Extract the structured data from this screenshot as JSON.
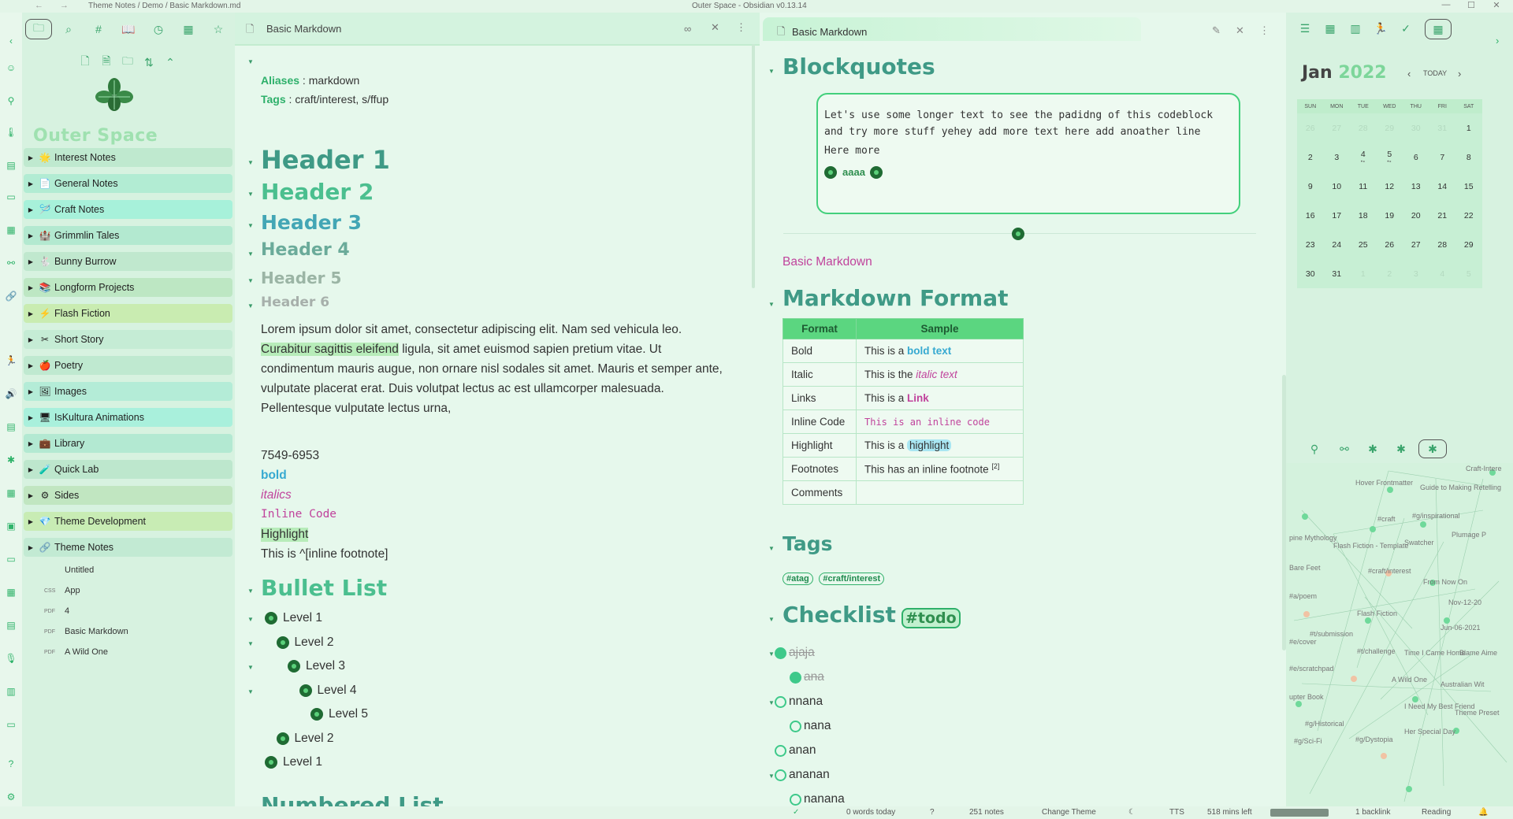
{
  "titlebar": {
    "path": "Theme Notes / Demo / Basic Markdown.md",
    "title": "Outer Space - Obsidian v0.13.14",
    "back": "←",
    "forward": "→",
    "minimize": "—",
    "maximize": "☐",
    "close": "✕"
  },
  "ribbon": {
    "icons": [
      "chevron-left-icon",
      "smile-icon",
      "bike-icon",
      "thermometer-icon",
      "layers-icon",
      "film-icon",
      "calendar-icon",
      "network-icon",
      "link-icon",
      "run-icon",
      "speaker-icon",
      "document-icon",
      "graph-icon",
      "calendar-2-icon",
      "gallery-icon",
      "cards-icon",
      "grid-icon",
      "table-icon",
      "mic-icon",
      "layout-icon",
      "id-card-icon",
      "help-icon",
      "settings-icon"
    ]
  },
  "left_sidebar": {
    "vault_name": "Outer Space",
    "folders": [
      {
        "name": "Interest Notes",
        "icon": "🌟",
        "color": "#bfe9cf"
      },
      {
        "name": "General Notes",
        "icon": "📄",
        "color": "#b2ecd3"
      },
      {
        "name": "Craft Notes",
        "icon": "🪡",
        "color": "#a7f1da"
      },
      {
        "name": "Grimmlin Tales",
        "icon": "🏰",
        "color": "#b3e9d0"
      },
      {
        "name": "Bunny Burrow",
        "icon": "🐇",
        "color": "#c0e8ce"
      },
      {
        "name": "Longform Projects",
        "icon": "📚",
        "color": "#bde7c3"
      },
      {
        "name": "Flash Fiction",
        "icon": "⚡",
        "color": "#c9ecb1"
      },
      {
        "name": "Short Story",
        "icon": "✂",
        "color": "#c5ecd5"
      },
      {
        "name": "Poetry",
        "icon": "🍎",
        "color": "#bfe9d0"
      },
      {
        "name": "Images",
        "icon": "🖼",
        "color": "#b4ecd7"
      },
      {
        "name": "IsKultura Animations",
        "icon": "🖥",
        "color": "#a9f0dc"
      },
      {
        "name": "Library",
        "icon": "💼",
        "color": "#b3e9d2"
      },
      {
        "name": "Quick Lab",
        "icon": "🧪",
        "color": "#bde7cd"
      },
      {
        "name": "Sides",
        "icon": "⚙",
        "color": "#c1e6c1"
      },
      {
        "name": "Theme Development",
        "icon": "💎",
        "color": "#c8ecb4"
      },
      {
        "name": "Theme Notes",
        "icon": "🔗",
        "color": "#c2ead3"
      }
    ],
    "files": [
      {
        "badge": "",
        "name": "Untitled"
      },
      {
        "badge": "CSS",
        "name": "App"
      },
      {
        "badge": "PDF",
        "name": "4"
      },
      {
        "badge": "PDF",
        "name": "Basic Markdown"
      },
      {
        "badge": "PDF",
        "name": "A Wild One"
      }
    ]
  },
  "center": {
    "tab_title": "Basic Markdown",
    "aliases_key": "Aliases",
    "aliases_value": "markdown",
    "tags_key": "Tags",
    "tags_value": "craft/interest, s/ffup",
    "h1": "Header 1",
    "h2": "Header 2",
    "h3": "Header 3",
    "h4": "Header 4",
    "h5": "Header 5",
    "h6": "Header 6",
    "para_1": "Lorem ipsum dolor sit amet, consectetur adipiscing elit. Nam sed vehicula leo. ",
    "para_hl": "Curabitur sagittis eleifend",
    "para_2": " ligula, sit amet euismod sapien pretium vitae. Ut condimentum mauris augue, non ornare nisl sodales sit amet. Mauris et semper ante, vulputate placerat erat. Duis volutpat lectus ac est ullamcorper malesuada. Pellentesque vulputate lectus urna,",
    "phone": "7549-6953",
    "bold": "bold",
    "italics": "italics",
    "inline_code": "Inline Code",
    "highlight": "Highlight",
    "footnote_line": "This is ^[inline footnote]",
    "bullet_header": "Bullet List",
    "bullets": [
      "Level 1",
      "Level 2",
      "Level 3",
      "Level 4",
      "Level 5",
      "Level 2",
      "Level 1"
    ],
    "next_header": "Numbered List"
  },
  "right": {
    "tab_title": "Basic Markdown",
    "blockquotes_header": "Blockquotes",
    "quote_text": "Let's use some longer text to see the padidng of this codeblock and try more stuff yehey add more text here add anoather line",
    "quote_more": "Here more",
    "quote_aaaa": "aaaa",
    "link_title": "Basic Markdown",
    "format_header": "Markdown Format",
    "table_headers": [
      "Format",
      "Sample"
    ],
    "table_rows": [
      {
        "format": "Bold",
        "prefix": "This is a ",
        "sample": "bold text"
      },
      {
        "format": "Italic",
        "prefix": "This is the ",
        "sample": "italic text"
      },
      {
        "format": "Links",
        "prefix": "This is a ",
        "sample": "Link"
      },
      {
        "format": "Inline Code",
        "prefix": "",
        "sample": "This is an inline code"
      },
      {
        "format": "Highlight",
        "prefix": "This is a ",
        "sample": "highlight"
      },
      {
        "format": "Footnotes",
        "prefix": "This has an inline footnote ",
        "sample": "[2]"
      },
      {
        "format": "Comments",
        "prefix": "",
        "sample": ""
      }
    ],
    "tags_header": "Tags",
    "tags": [
      "#atag",
      "#craft/interest"
    ],
    "checklist_header": "Checklist",
    "checklist_tag": "#todo",
    "checklist": [
      {
        "text": "ajaja",
        "done": true
      },
      {
        "text": "ana",
        "done": true
      },
      {
        "text": "nnana",
        "done": false
      },
      {
        "text": "nana",
        "done": false
      },
      {
        "text": "anan",
        "done": false
      },
      {
        "text": "ananan",
        "done": false
      },
      {
        "text": "nanana",
        "done": false
      }
    ]
  },
  "calendar": {
    "month": "Jan",
    "year": "2022",
    "today": "TODAY",
    "days": [
      "SUN",
      "MON",
      "TUE",
      "WED",
      "THU",
      "FRI",
      "SAT"
    ],
    "weeks": [
      [
        "26",
        "27",
        "28",
        "29",
        "30",
        "31",
        "1"
      ],
      [
        "2",
        "3",
        "4",
        "5",
        "6",
        "7",
        "8"
      ],
      [
        "9",
        "10",
        "11",
        "12",
        "13",
        "14",
        "15"
      ],
      [
        "16",
        "17",
        "18",
        "19",
        "20",
        "21",
        "22"
      ],
      [
        "23",
        "24",
        "25",
        "26",
        "27",
        "28",
        "29"
      ],
      [
        "30",
        "31",
        "1",
        "2",
        "3",
        "4",
        "5"
      ]
    ]
  },
  "graph": {
    "labels": [
      "Craft-Intere",
      "Hover Frontmatter",
      "Guide to Making Retelling",
      "#g/inspirational",
      "#craft",
      "Plumage P",
      "pine Mythology",
      "Flash Fiction - Template",
      "Swatcher",
      "Bare Feet",
      "#craft/interest",
      "From Now On",
      "#a/poem",
      "Nov-12-20",
      "Flash Fiction",
      "#t/submission",
      "Jun-06-2021",
      "#e/cover",
      "#t/challenge",
      "Time I Came Home",
      "Blame Aime",
      "#e/scratchpad",
      "A Wild One",
      "Australian Wit",
      "upter Book",
      "I Need My Best Friend",
      "Theme Preset",
      "#g/Historical",
      "#g/Sci-Fi",
      "Her Special Day",
      "#g/Dystopia"
    ]
  },
  "status": {
    "words": "0 words today",
    "notes": "251 notes",
    "change_theme": "Change Theme",
    "tts": "TTS",
    "mins": "518 mins left",
    "backlinks": "1 backlink",
    "mode": "Reading"
  },
  "colors": {
    "accent": "#2fb36a",
    "h1": "#3f9a86",
    "h2": "#4bbf8f",
    "h3": "#43a6b5",
    "h4": "#6bab9a",
    "h5": "#9bb5a5",
    "h6": "#a7b0ab",
    "pink": "#c0439c"
  }
}
